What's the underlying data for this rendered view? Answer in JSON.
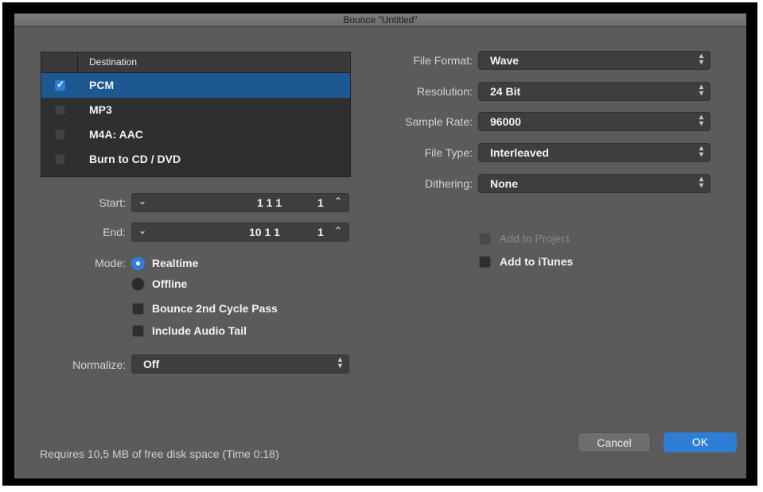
{
  "window": {
    "title": "Bounce \"Untitled\""
  },
  "destination": {
    "header": "Destination",
    "rows": [
      {
        "label": "PCM",
        "checked": true,
        "selected": true
      },
      {
        "label": "MP3",
        "checked": false,
        "selected": false
      },
      {
        "label": "M4A: AAC",
        "checked": false,
        "selected": false
      },
      {
        "label": "Burn to CD / DVD",
        "checked": false,
        "selected": false
      }
    ]
  },
  "range": {
    "start_label": "Start:",
    "start_value": "1 1 1",
    "start_tick": "1",
    "end_label": "End:",
    "end_value": "10 1 1",
    "end_tick": "1"
  },
  "mode": {
    "label": "Mode:",
    "realtime": "Realtime",
    "offline": "Offline",
    "selected": "Realtime",
    "bounce_2nd_cycle": "Bounce 2nd Cycle Pass",
    "include_audio_tail": "Include Audio Tail"
  },
  "normalize": {
    "label": "Normalize:",
    "value": "Off"
  },
  "format": {
    "file_format_label": "File Format:",
    "file_format": "Wave",
    "resolution_label": "Resolution:",
    "resolution": "24 Bit",
    "sample_rate_label": "Sample Rate:",
    "sample_rate": "96000",
    "file_type_label": "File Type:",
    "file_type": "Interleaved",
    "dithering_label": "Dithering:",
    "dithering": "None"
  },
  "options": {
    "add_to_project": "Add to Project",
    "add_to_itunes": "Add to iTunes"
  },
  "footer": {
    "status": "Requires 10,5 MB of free disk space  (Time 0:18)"
  },
  "buttons": {
    "cancel": "Cancel",
    "ok": "OK"
  },
  "colors": {
    "accent": "#2e7ed6",
    "selection": "#1d5891",
    "window_bg": "#5b5b5b"
  }
}
